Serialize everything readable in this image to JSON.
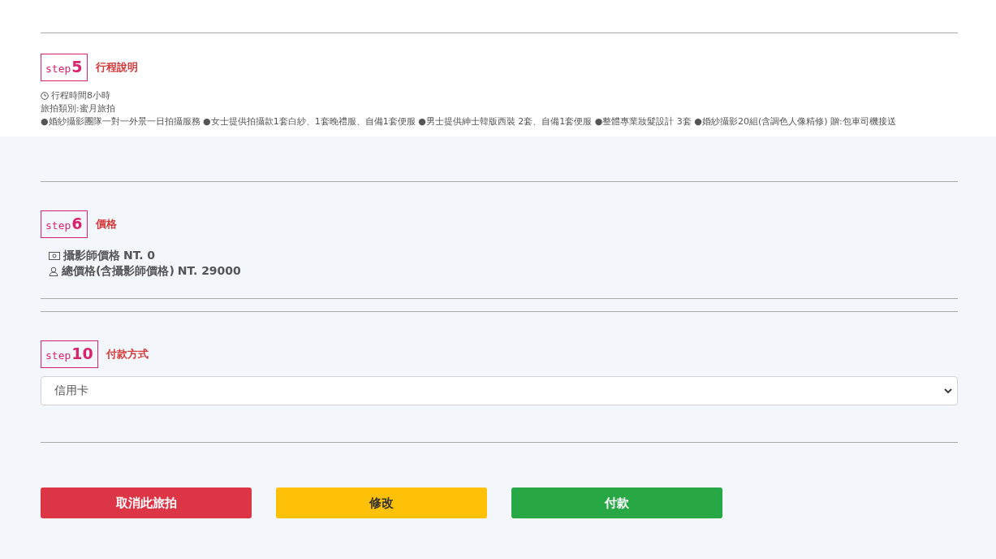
{
  "itinerary": {
    "step_label": "step",
    "step_number": "5",
    "title": "行程說明",
    "duration": "行程時間8小時",
    "category": "旅拍類別:蜜月旅拍",
    "details": "●婚紗攝影團隊一對一外景一日拍攝服務 ●女士提供拍攝款1套白紗、1套晚禮服、自備1套便服 ●男士提供紳士韓版西裝 2套、自備1套便服 ●整體專業妝髮設計 3套 ●婚紗攝影20組(含調色人像精修) 贈:包車司機接送"
  },
  "price": {
    "step_label": "step",
    "step_number": "6",
    "title": "價格",
    "lines": [
      {
        "kind": "money",
        "label": "攝影師價格",
        "value": "NT. 0"
      },
      {
        "kind": "person",
        "label": "總價格(含攝影師價格)",
        "value": "NT. 29000"
      }
    ]
  },
  "payment": {
    "step_label": "step",
    "step_number": "10",
    "title": "付款方式",
    "value": "信用卡"
  },
  "buttons": [
    {
      "kind": "danger",
      "label": "取消此旅拍"
    },
    {
      "kind": "warning",
      "label": "修改"
    },
    {
      "kind": "success",
      "label": "付款"
    }
  ]
}
